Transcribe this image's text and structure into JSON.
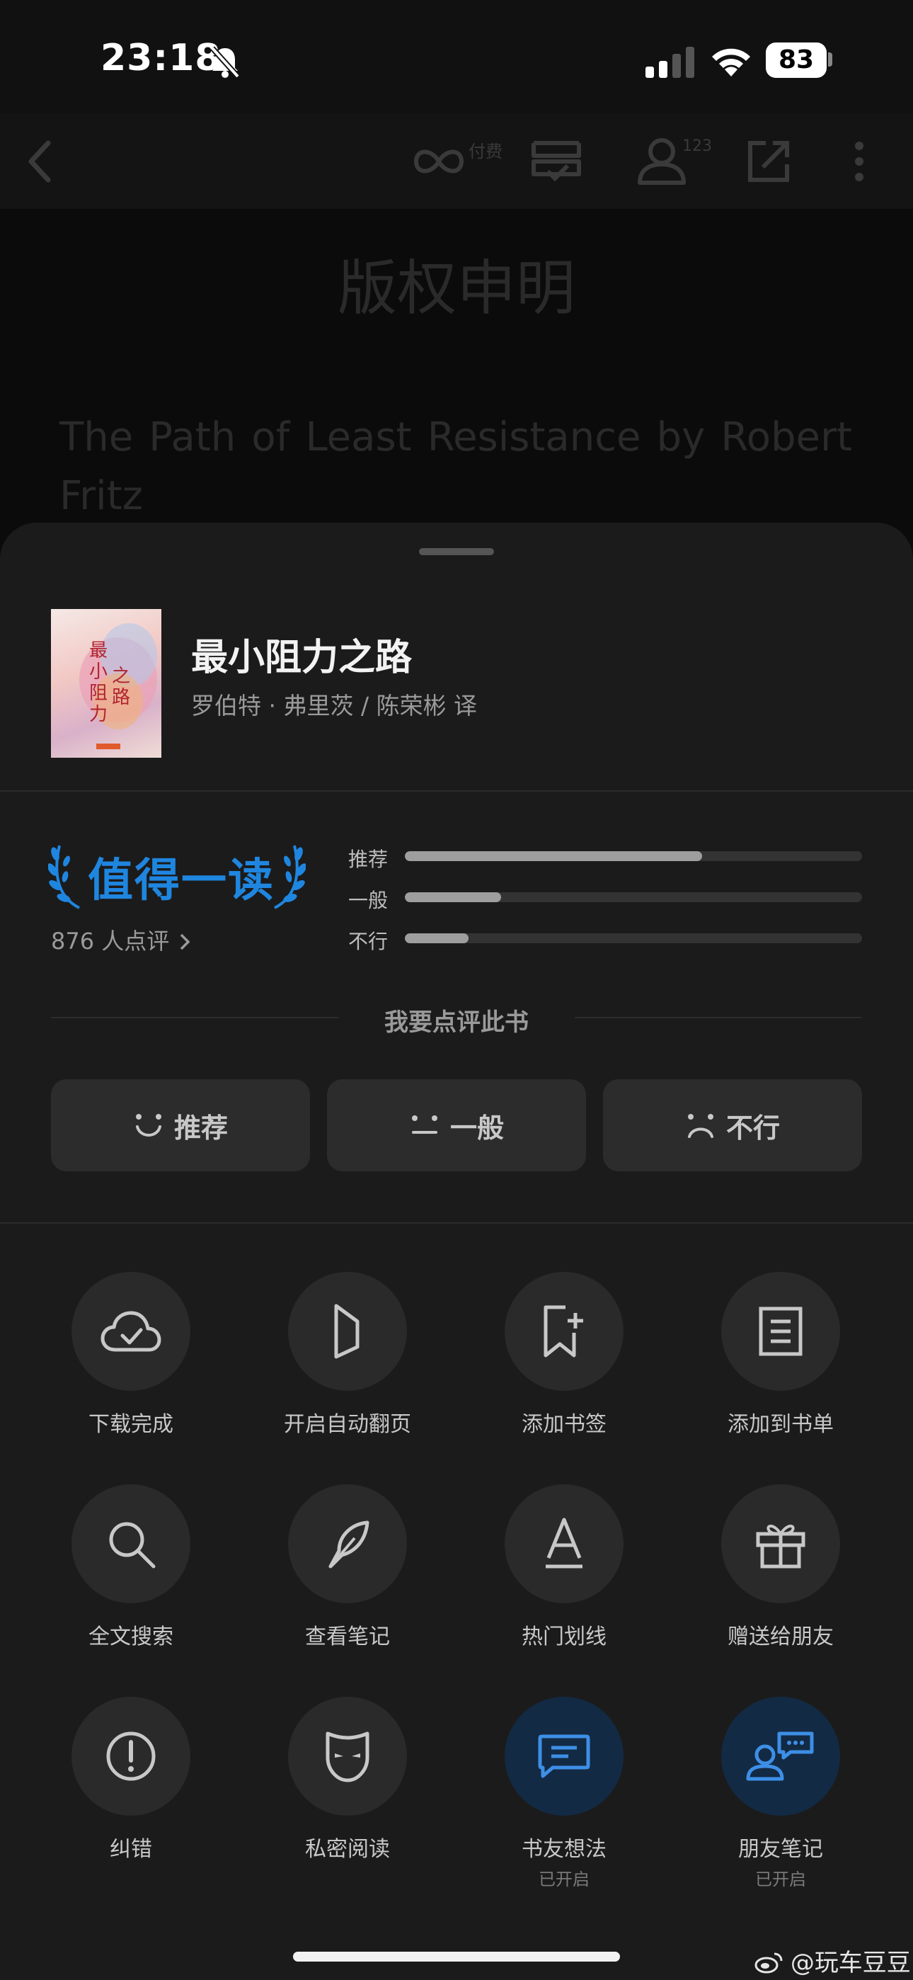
{
  "status_bar": {
    "time": "23:18",
    "battery": "83"
  },
  "topbar": {
    "paid_label": "付费",
    "reader_count": "123",
    "icons": [
      "back-icon",
      "paid-icon",
      "bookshelf-icon",
      "readers-icon",
      "share-icon",
      "more-icon"
    ]
  },
  "page": {
    "title": "版权申明",
    "body_line1": "The Path of Least Resistance by Robert",
    "body_line2": "Fritz"
  },
  "book": {
    "title": "最小阻力之路",
    "author": "罗伯特 · 弗里茨 / 陈荣彬 译",
    "cover_title_a": "最小阻力",
    "cover_title_b": "之路"
  },
  "rating": {
    "badge": "值得一读",
    "review_count": "876 人点评",
    "bars": [
      {
        "label": "推荐",
        "fraction": 0.65
      },
      {
        "label": "一般",
        "fraction": 0.21
      },
      {
        "label": "不行",
        "fraction": 0.14
      }
    ],
    "prompt": "我要点评此书",
    "buttons": [
      {
        "label": "推荐",
        "icon": "smile-icon"
      },
      {
        "label": "一般",
        "icon": "neutral-face-icon"
      },
      {
        "label": "不行",
        "icon": "frown-icon"
      }
    ]
  },
  "actions": [
    {
      "label": "下载完成",
      "icon": "cloud-check-icon"
    },
    {
      "label": "开启自动翻页",
      "icon": "auto-page-icon"
    },
    {
      "label": "添加书签",
      "icon": "bookmark-add-icon"
    },
    {
      "label": "添加到书单",
      "icon": "list-document-icon"
    },
    {
      "label": "全文搜索",
      "icon": "search-icon"
    },
    {
      "label": "查看笔记",
      "icon": "feather-icon"
    },
    {
      "label": "热门划线",
      "icon": "underline-a-icon"
    },
    {
      "label": "赠送给朋友",
      "icon": "gift-icon"
    },
    {
      "label": "纠错",
      "icon": "exclamation-icon"
    },
    {
      "label": "私密阅读",
      "icon": "mask-icon"
    },
    {
      "label": "书友想法",
      "sub": "已开启",
      "icon": "comment-icon",
      "active": true
    },
    {
      "label": "朋友笔记",
      "sub": "已开启",
      "icon": "friend-note-icon",
      "active": true
    }
  ],
  "watermark": "@玩车豆豆",
  "colors": {
    "accent": "#1f86e0",
    "sheet": "#1b1b1b",
    "active_circle": "#132a44"
  }
}
